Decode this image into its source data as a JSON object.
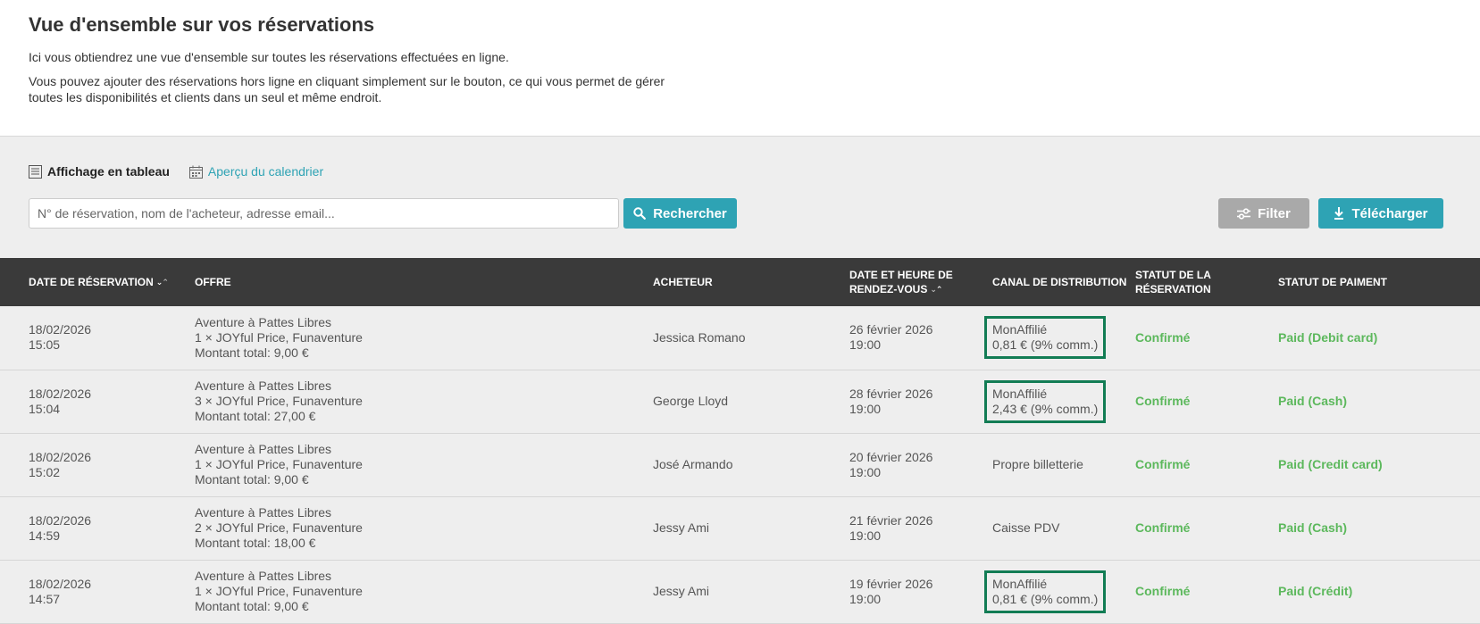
{
  "intro": {
    "title": "Vue d'ensemble sur vos réservations",
    "text1": "Ici vous obtiendrez une vue d'ensemble sur toutes les réservations effectuées en ligne.",
    "text2": "Vous pouvez ajouter des réservations hors ligne en cliquant simplement sur le bouton, ce qui vous permet de gérer toutes les disponibilités et clients dans un seul et même endroit."
  },
  "views": {
    "table_label": "Affichage en tableau",
    "calendar_label": "Aperçu du calendrier"
  },
  "search": {
    "placeholder": "N° de réservation, nom de l'acheteur, adresse email...",
    "value": "",
    "button_label": "Rechercher"
  },
  "actions": {
    "filter_label": "Filter",
    "download_label": "Télécharger"
  },
  "colors": {
    "accent": "#2ea3b4",
    "header_bg": "#3a3a3a",
    "status_green": "#5cb85c",
    "highlight_border": "#127c54",
    "filter_gray": "#a9a9a9"
  },
  "table": {
    "headers": [
      "Date de réservation",
      "Offre",
      "Acheteur",
      "Date et heure de rendez-vous",
      "Canal de distribution",
      "Statut de la réservation",
      "Statut de paiment"
    ],
    "rows": [
      {
        "date": "18/02/2026",
        "time": "15:05",
        "offer_name": "Aventure à Pattes Libres",
        "offer_detail": "1 × JOYful Price, Funaventure",
        "offer_total": "Montant total: 9,00 €",
        "buyer": "Jessica Romano",
        "appt_date": "26 février 2026",
        "appt_time": "19:00",
        "canal": "MonAffilié",
        "canal_comm": "0,81 € (9% comm.)",
        "highlight": true,
        "status": "Confirmé",
        "payment": "Paid (Debit card)"
      },
      {
        "date": "18/02/2026",
        "time": "15:04",
        "offer_name": "Aventure à Pattes Libres",
        "offer_detail": "3 × JOYful Price, Funaventure",
        "offer_total": "Montant total: 27,00 €",
        "buyer": "George Lloyd",
        "appt_date": "28 février 2026",
        "appt_time": "19:00",
        "canal": "MonAffilié",
        "canal_comm": "2,43 € (9% comm.)",
        "highlight": true,
        "status": "Confirmé",
        "payment": "Paid (Cash)"
      },
      {
        "date": "18/02/2026",
        "time": "15:02",
        "offer_name": "Aventure à Pattes Libres",
        "offer_detail": "1 × JOYful Price, Funaventure",
        "offer_total": "Montant total: 9,00 €",
        "buyer": "José Armando",
        "appt_date": "20 février 2026",
        "appt_time": "19:00",
        "canal": "Propre billetterie",
        "canal_comm": "",
        "highlight": false,
        "status": "Confirmé",
        "payment": "Paid (Credit card)"
      },
      {
        "date": "18/02/2026",
        "time": "14:59",
        "offer_name": "Aventure à Pattes Libres",
        "offer_detail": "2 × JOYful Price, Funaventure",
        "offer_total": "Montant total: 18,00 €",
        "buyer": "Jessy Ami",
        "appt_date": "21 février 2026",
        "appt_time": "19:00",
        "canal": "Caisse PDV",
        "canal_comm": "",
        "highlight": false,
        "status": "Confirmé",
        "payment": "Paid (Cash)"
      },
      {
        "date": "18/02/2026",
        "time": "14:57",
        "offer_name": "Aventure à Pattes Libres",
        "offer_detail": "1 × JOYful Price, Funaventure",
        "offer_total": "Montant total: 9,00 €",
        "buyer": "Jessy Ami",
        "appt_date": "19 février 2026",
        "appt_time": "19:00",
        "canal": "MonAffilié",
        "canal_comm": "0,81 € (9% comm.)",
        "highlight": true,
        "status": "Confirmé",
        "payment": "Paid (Crédit)"
      }
    ]
  }
}
